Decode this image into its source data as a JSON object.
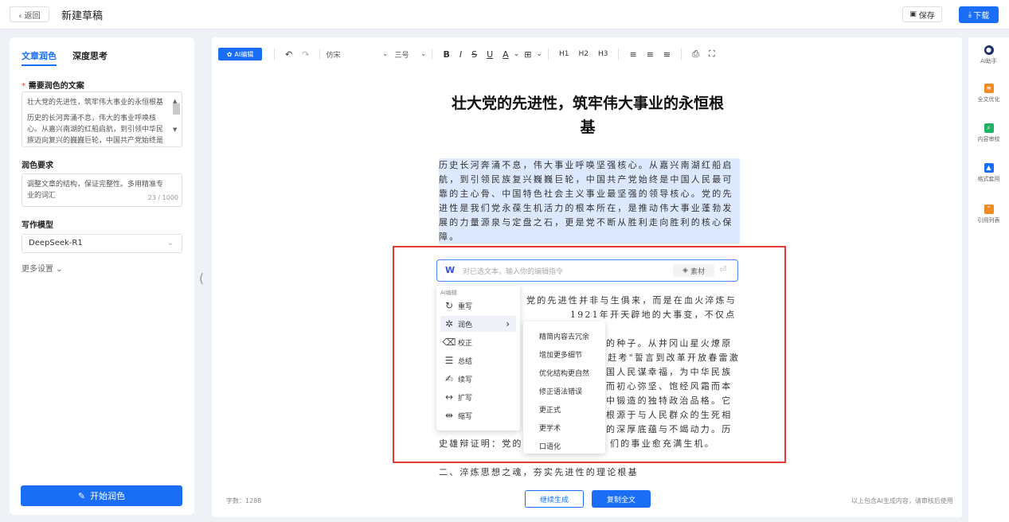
{
  "header": {
    "back_label": "‹ 返回",
    "title": "新建草稿",
    "save_label": "保存",
    "download_label": "下载"
  },
  "left_panel": {
    "tabs": [
      "文章润色",
      "深度思考"
    ],
    "source_label": "需要润色的文案",
    "source_text_line1": "壮大党的先进性，筑牢伟大事业的永恒根基",
    "source_text_line2": "历史的长河奔涌不息，伟大的事业呼唤核心。从嘉兴南湖的红船启航，到引领中华民族迈向复兴的巍巍巨轮，中国共产党始终是",
    "requirement_label": "润色要求",
    "requirement_text": "调整文章的结构，保证完整性。多用精准专业的词汇",
    "requirement_counter": "23 / 1000",
    "model_label": "写作模型",
    "model_value": "DeepSeek-R1",
    "more_settings": "更多设置 ⌄",
    "start_button": "开始润色"
  },
  "toolbar": {
    "ai_edit": "AI编辑",
    "font": "仿宋",
    "size": "三号",
    "bold": "B",
    "italic": "I",
    "strike": "S",
    "underline": "U",
    "color": "A",
    "h1": "H1",
    "h2": "H2",
    "h3": "H3"
  },
  "editor": {
    "title": "壮大党的先进性，筑牢伟大事业的永恒根基",
    "para1": "历史长河奔涌不息，伟大事业呼唤坚强核心。从嘉兴南湖红船启航，到引领民族复兴巍巍巨轮，中国共产党始终是中国人民最可靠的主心骨、中国特色社会主义事业最坚强的领导核心。党的先进性是我们党永葆生机活力的根本所在，是推动伟大事业蓬勃发展的力量源泉与定盘之石，更是党不断从胜利走向胜利的核心保障。",
    "para2_lines": [
      "党的先进性并非与生俱来，而是在血火淬炼与",
      "1921年开天辟地的大事变，不仅点燃了",
      "的种子。从井冈山星火燎原",
      "\"赶考\"誓言到改革开放春雷激",
      "国人民谋幸福，为中华民族",
      "而初心弥坚、饱经风霜而本",
      "中锻造的独特政治品格。它",
      "根源于与人民群众的生死相",
      "的深厚底蕴与不竭动力。历",
      "史雄辩证明：党的",
      "们的事业愈充满生机。"
    ],
    "para3": "二、淬炼思想之魂，夯实先进性的理论根基",
    "command_placeholder": "对已选文本，输入你的编辑指令",
    "material_label": "素材",
    "word_count": "字数：1288",
    "continue_button": "继续生成",
    "copy_button": "复制全文",
    "notice": "以上包含AI生成内容，请审核后使用"
  },
  "ai_menu": {
    "header": "AI编辑",
    "items": [
      {
        "label": "重写",
        "icon": "refresh-icon"
      },
      {
        "label": "润色",
        "icon": "sparkle-icon"
      },
      {
        "label": "校正",
        "icon": "eraser-icon"
      },
      {
        "label": "总结",
        "icon": "list-icon"
      },
      {
        "label": "续写",
        "icon": "pen-icon"
      },
      {
        "label": "扩写",
        "icon": "expand-icon"
      },
      {
        "label": "缩写",
        "icon": "shrink-icon"
      }
    ],
    "submenu": [
      "精简内容去冗余",
      "增加更多细节",
      "优化结构更自然",
      "修正语法错误",
      "更正式",
      "更学术",
      "口语化"
    ]
  },
  "right_bar": {
    "items": [
      {
        "label": "AI助手",
        "color": "#1d2f6b"
      },
      {
        "label": "全文优化",
        "color": "#f08a24"
      },
      {
        "label": "内容审校",
        "color": "#22b36b"
      },
      {
        "label": "格式套用",
        "color": "#1a6ef5"
      },
      {
        "label": "引用列表",
        "color": "#f08a24"
      }
    ]
  },
  "colors": {
    "accent": "#1a6ef5",
    "highlight": "#dbe8fd",
    "red_box": "#e53935"
  }
}
